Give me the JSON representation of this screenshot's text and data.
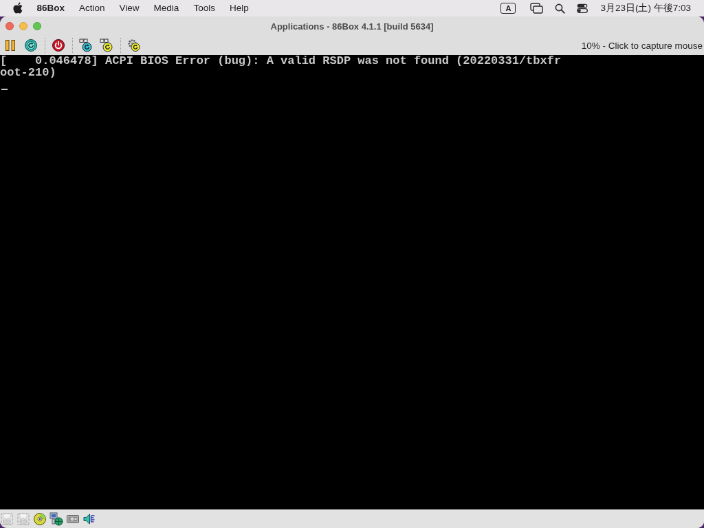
{
  "menu_bar": {
    "app_name": "86Box",
    "menus": [
      "Action",
      "View",
      "Media",
      "Tools",
      "Help"
    ],
    "input_source": "A",
    "clock": "3月23日(土) 午後7:03"
  },
  "window": {
    "title": "Applications - 86Box 4.1.1 [build 5634]"
  },
  "toolbar": {
    "status_text": "10% - Click to capture mouse"
  },
  "screen": {
    "lines": [
      "[    0.046478] ACPI BIOS Error (bug): A valid RSDP was not found (20220331/tbxfr",
      "oot-210)"
    ]
  }
}
